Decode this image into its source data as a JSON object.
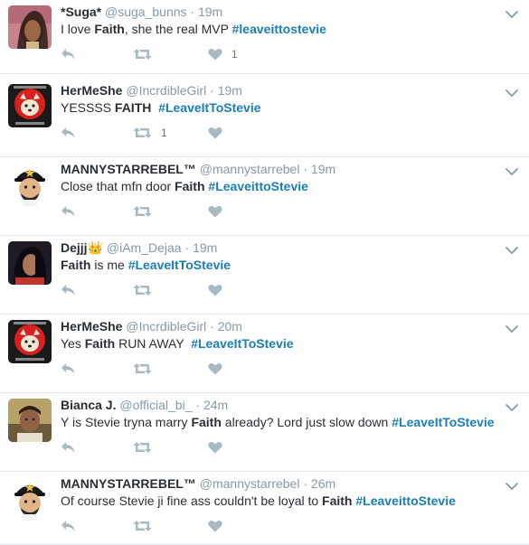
{
  "tweets": [
    {
      "name": "*Suga*",
      "handle": "@suga_bunns",
      "time": "19m",
      "segments": [
        {
          "t": "I love ",
          "s": "plain"
        },
        {
          "t": "Faith",
          "s": "bold"
        },
        {
          "t": ", she the real MVP ",
          "s": "plain"
        },
        {
          "t": "#leaveittostevie",
          "s": "tag"
        }
      ],
      "retweets": "",
      "likes": "1",
      "avatar": "woman-1"
    },
    {
      "name": "HerMeShe",
      "handle": "@IncrdibleGirl",
      "time": "19m",
      "segments": [
        {
          "t": "YESSSS ",
          "s": "plain"
        },
        {
          "t": "FAITH",
          "s": "bold"
        },
        {
          "t": "  ",
          "s": "plain"
        },
        {
          "t": "#LeaveItToStevie",
          "s": "tag"
        }
      ],
      "retweets": "1",
      "likes": "",
      "avatar": "dog-red"
    },
    {
      "name": "MANNYSTARREBEL™",
      "handle": "@mannystarrebel",
      "time": "19m",
      "segments": [
        {
          "t": "Close that mfn door ",
          "s": "plain"
        },
        {
          "t": "Faith",
          "s": "bold"
        },
        {
          "t": " ",
          "s": "plain"
        },
        {
          "t": "#LeaveittoStevie",
          "s": "tag"
        }
      ],
      "retweets": "",
      "likes": "",
      "avatar": "cartoon-man"
    },
    {
      "name": "Dejjj👑",
      "handle": "@iAm_Dejaa",
      "time": "19m",
      "segments": [
        {
          "t": "Faith",
          "s": "bold"
        },
        {
          "t": " is me ",
          "s": "plain"
        },
        {
          "t": "#LeaveItToStevie",
          "s": "tag"
        }
      ],
      "retweets": "",
      "likes": "",
      "avatar": "woman-2"
    },
    {
      "name": "HerMeShe",
      "handle": "@IncrdibleGirl",
      "time": "20m",
      "segments": [
        {
          "t": "Yes ",
          "s": "plain"
        },
        {
          "t": "Faith",
          "s": "bold"
        },
        {
          "t": " RUN AWAY  ",
          "s": "plain"
        },
        {
          "t": "#LeaveItToStevie",
          "s": "tag"
        }
      ],
      "retweets": "",
      "likes": "",
      "avatar": "dog-red"
    },
    {
      "name": "Bianca J.",
      "handle": "@official_bi_",
      "time": "24m",
      "segments": [
        {
          "t": "Y is Stevie tryna marry ",
          "s": "plain"
        },
        {
          "t": "Faith",
          "s": "bold"
        },
        {
          "t": " already? Lord just slow down ",
          "s": "plain"
        },
        {
          "t": "#LeaveItToStevie",
          "s": "tag"
        }
      ],
      "retweets": "",
      "likes": "",
      "avatar": "man-photo"
    },
    {
      "name": "MANNYSTARREBEL™",
      "handle": "@mannystarrebel",
      "time": "26m",
      "segments": [
        {
          "t": "Of course Stevie ji fine ass couldn't be loyal to ",
          "s": "plain"
        },
        {
          "t": "Faith",
          "s": "bold"
        },
        {
          "t": " ",
          "s": "plain"
        },
        {
          "t": "#LeaveittoStevie",
          "s": "tag"
        }
      ],
      "retweets": "",
      "likes": "",
      "avatar": "cartoon-man"
    }
  ],
  "icons": {
    "reply": "reply-icon",
    "retweet": "retweet-icon",
    "like": "heart-icon",
    "more": "chevron-down-icon"
  },
  "colors": {
    "hashtag": "#1b7eb5",
    "icon": "#aab8c2",
    "muted": "#8899a6",
    "divider": "#e1e8ed"
  }
}
